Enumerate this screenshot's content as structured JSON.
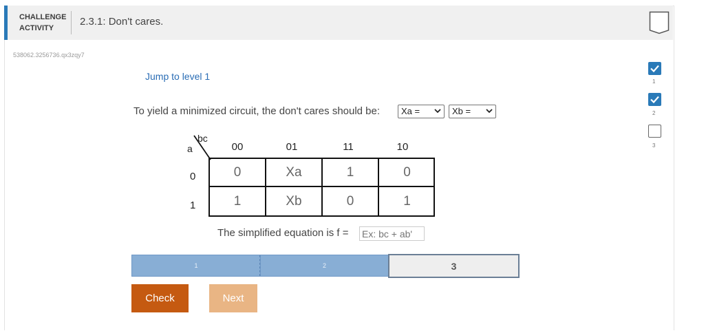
{
  "header": {
    "label": "CHALLENGE ACTIVITY",
    "title": "2.3.1: Don't cares."
  },
  "activity_id": "538062.3256736.qx3zqy7",
  "jump": {
    "label": "Jump to level 1"
  },
  "prompt": {
    "text": "To yield a minimized circuit, the don't cares should be:"
  },
  "selects": [
    {
      "value": "Xa ="
    },
    {
      "value": "Xb ="
    }
  ],
  "kmap": {
    "row_var": "a",
    "col_var": "bc",
    "columns": [
      "00",
      "01",
      "11",
      "10"
    ],
    "rows": [
      {
        "label": "0",
        "cells": [
          "0",
          "Xa",
          "1",
          "0"
        ]
      },
      {
        "label": "1",
        "cells": [
          "1",
          "Xb",
          "0",
          "1"
        ]
      }
    ]
  },
  "equation": {
    "label": "The simplified equation is f =",
    "placeholder": "Ex: bc + ab'"
  },
  "progress": {
    "segments": [
      {
        "label": "1",
        "state": "done"
      },
      {
        "label": "2",
        "state": "done"
      },
      {
        "label": "3",
        "state": "current"
      }
    ]
  },
  "buttons": {
    "check": "Check",
    "next": "Next"
  },
  "levels": [
    {
      "num": "1",
      "state": "complete",
      "icon": "check-icon"
    },
    {
      "num": "2",
      "state": "complete",
      "icon": "check-icon"
    },
    {
      "num": "3",
      "state": "incomplete",
      "icon": "empty-box-icon"
    }
  ],
  "colors": {
    "accent": "#2a7ab8",
    "check_button": "#c55a11",
    "next_button": "#e9b584",
    "progress_done": "#88aed5"
  }
}
